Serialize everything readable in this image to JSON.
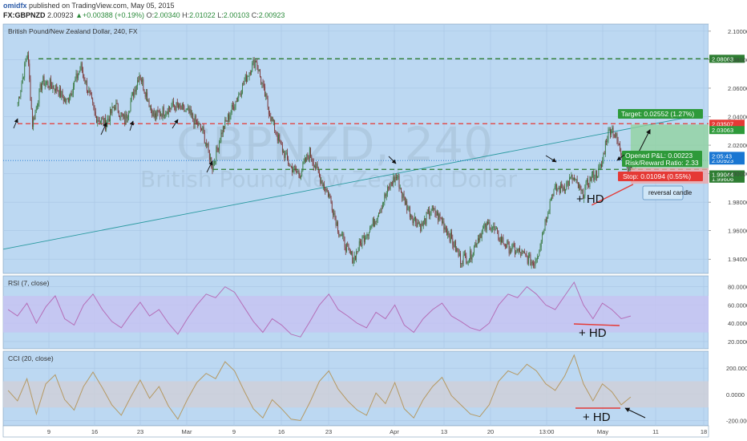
{
  "header": {
    "author": "omidfx",
    "published": "published on TradingView.com, May 05, 2015",
    "symbol": "FX:GBPNZD",
    "price": "2.00923",
    "change": "+0.00388 (+0.19%)",
    "open_label": "O:",
    "open": "2.00340",
    "high_label": "H:",
    "high": "2.01022",
    "low_label": "L:",
    "low": "2.00103",
    "close_label": "C:",
    "close": "2.00923"
  },
  "chart_data": [
    {
      "type": "candlestick",
      "title": "British Pound/New Zealand Dollar, 240, FX",
      "watermark": "GBPNZD, 240",
      "watermark_sub": "British Pound/New Zealand Dollar",
      "x_tick_labels": [
        "9",
        "16",
        "23",
        "Mar",
        "9",
        "16",
        "23",
        "Apr",
        "13",
        "20",
        "13:00",
        "May",
        "11",
        "18"
      ],
      "y_tick_labels": [
        "2.10000",
        "2.08000",
        "2.06000",
        "2.04000",
        "2.02000",
        "2.00000",
        "1.98000",
        "1.96000",
        "1.94000"
      ],
      "ylim": [
        1.93,
        2.105
      ],
      "series": [
        {
          "values": [
            {
              "day": 0,
              "close": 2.05
            },
            {
              "day": 2,
              "close": 2.085
            },
            {
              "day": 3,
              "close": 2.035
            },
            {
              "day": 5,
              "close": 2.065
            },
            {
              "day": 8,
              "close": 2.06
            },
            {
              "day": 10,
              "close": 2.05
            },
            {
              "day": 13,
              "close": 2.075
            },
            {
              "day": 16,
              "close": 2.04
            },
            {
              "day": 18,
              "close": 2.035
            },
            {
              "day": 20,
              "close": 2.048
            },
            {
              "day": 22,
              "close": 2.037
            },
            {
              "day": 25,
              "close": 2.07
            },
            {
              "day": 28,
              "close": 2.04
            },
            {
              "day": 32,
              "close": 2.048
            },
            {
              "day": 35,
              "close": 2.043
            },
            {
              "day": 38,
              "close": 2.03
            },
            {
              "day": 40,
              "close": 2.005
            },
            {
              "day": 42,
              "close": 2.03
            },
            {
              "day": 44,
              "close": 2.045
            },
            {
              "day": 46,
              "close": 2.06
            },
            {
              "day": 48,
              "close": 2.075
            },
            {
              "day": 49,
              "close": 2.08
            },
            {
              "day": 50,
              "close": 2.065
            },
            {
              "day": 52,
              "close": 2.04
            },
            {
              "day": 54,
              "close": 2.02
            },
            {
              "day": 56,
              "close": 2.005
            },
            {
              "day": 58,
              "close": 2.0
            },
            {
              "day": 60,
              "close": 2.015
            },
            {
              "day": 62,
              "close": 1.998
            },
            {
              "day": 64,
              "close": 1.985
            },
            {
              "day": 66,
              "close": 1.96
            },
            {
              "day": 68,
              "close": 1.945
            },
            {
              "day": 69,
              "close": 1.94
            },
            {
              "day": 71,
              "close": 1.955
            },
            {
              "day": 73,
              "close": 1.965
            },
            {
              "day": 75,
              "close": 1.98
            },
            {
              "day": 77,
              "close": 1.995
            },
            {
              "day": 78,
              "close": 1.998
            },
            {
              "day": 79,
              "close": 1.985
            },
            {
              "day": 81,
              "close": 1.97
            },
            {
              "day": 83,
              "close": 1.963
            },
            {
              "day": 85,
              "close": 1.975
            },
            {
              "day": 87,
              "close": 1.968
            },
            {
              "day": 89,
              "close": 1.955
            },
            {
              "day": 91,
              "close": 1.94
            },
            {
              "day": 93,
              "close": 1.942
            },
            {
              "day": 95,
              "close": 1.958
            },
            {
              "day": 97,
              "close": 1.965
            },
            {
              "day": 99,
              "close": 1.955
            },
            {
              "day": 101,
              "close": 1.948
            },
            {
              "day": 103,
              "close": 1.945
            },
            {
              "day": 105,
              "close": 1.94
            },
            {
              "day": 106,
              "close": 1.937
            },
            {
              "day": 107,
              "close": 1.945
            },
            {
              "day": 108,
              "close": 1.96
            },
            {
              "day": 109,
              "close": 1.975
            },
            {
              "day": 110,
              "close": 1.988
            },
            {
              "day": 112,
              "close": 1.99
            },
            {
              "day": 114,
              "close": 1.997
            },
            {
              "day": 115,
              "close": 1.992
            },
            {
              "day": 116,
              "close": 1.985
            },
            {
              "day": 117,
              "close": 1.992
            },
            {
              "day": 118,
              "close": 1.998
            },
            {
              "day": 119,
              "close": 2.0
            },
            {
              "day": 120,
              "close": 2.005
            },
            {
              "day": 121,
              "close": 2.025
            },
            {
              "day": 122,
              "close": 2.033
            },
            {
              "day": 123,
              "close": 2.025
            },
            {
              "day": 124,
              "close": 2.015
            },
            {
              "day": 125,
              "close": 2.008
            },
            {
              "day": 126,
              "close": 2.004
            },
            {
              "day": 127,
              "close": 2.009
            }
          ]
        }
      ],
      "levels": [
        {
          "name": "resistance-top",
          "value": 2.08063,
          "label": "2.08063",
          "color": "#2e7d32",
          "style": "dashed"
        },
        {
          "name": "resistance-mid",
          "value": 2.03507,
          "label": "2.03507",
          "color": "#e53935",
          "style": "dashed"
        },
        {
          "name": "support",
          "value": 2.003,
          "label": "1.99606",
          "color": "#2e7d32",
          "style": "dashed"
        },
        {
          "name": "last-price",
          "value": 2.00923,
          "label": "2.00923",
          "color": "#1976d2",
          "style": "dotted"
        }
      ],
      "trendline": {
        "from": {
          "day": -3,
          "value": 1.947
        },
        "to": {
          "day": 140,
          "value": 2.041
        }
      },
      "annotations": {
        "target": "Target: 0.02552 (1.27%)",
        "pnl": "Opened P&L: 0.00223",
        "risk_reward": "Risk/Reward Ratio: 2.33",
        "stop": "Stop: 0.01094 (0.55%)",
        "reversal": "reversal candle",
        "hd": "+ HD",
        "target_tag": "2.03063",
        "time_tag": "2:05:43",
        "stop_tag": "1.99044"
      }
    },
    {
      "type": "line",
      "title": "RSI (7, close)",
      "y_tick_labels": [
        "80.0000",
        "60.0000",
        "40.0000",
        "20.0000"
      ],
      "ylim": [
        12,
        92
      ],
      "band": [
        30,
        70
      ],
      "series": [
        {
          "name": "",
          "values": [
            55,
            48,
            62,
            40,
            58,
            70,
            45,
            38,
            60,
            72,
            55,
            42,
            35,
            50,
            63,
            48,
            55,
            40,
            28,
            45,
            60,
            72,
            68,
            80,
            74,
            58,
            42,
            30,
            45,
            38,
            28,
            25,
            42,
            60,
            72,
            55,
            48,
            40,
            35,
            52,
            45,
            60,
            38,
            30,
            45,
            55,
            62,
            48,
            42,
            35,
            32,
            40,
            60,
            72,
            68,
            80,
            72,
            60,
            55,
            70,
            85,
            60,
            45,
            62,
            55,
            45,
            48
          ]
        }
      ],
      "annotation": "+ HD"
    },
    {
      "type": "line",
      "title": "CCI (20, close)",
      "y_tick_labels": [
        "200.0000",
        "0.0000",
        "-200.0000"
      ],
      "ylim": [
        -240,
        330
      ],
      "band": [
        -100,
        100
      ],
      "series": [
        {
          "name": "",
          "values": [
            30,
            -50,
            120,
            -150,
            80,
            150,
            -40,
            -120,
            60,
            170,
            50,
            -80,
            -160,
            -20,
            110,
            -30,
            60,
            -90,
            -190,
            -40,
            90,
            160,
            120,
            250,
            180,
            30,
            -110,
            -180,
            -40,
            -110,
            -190,
            -200,
            -60,
            100,
            180,
            40,
            -50,
            -120,
            -160,
            10,
            -70,
            90,
            -110,
            -180,
            -40,
            60,
            130,
            -10,
            -80,
            -150,
            -170,
            -80,
            100,
            180,
            150,
            230,
            180,
            80,
            30,
            140,
            300,
            80,
            -50,
            80,
            20,
            -80,
            -20
          ]
        }
      ],
      "annotation": "+ HD"
    }
  ],
  "colors": {
    "background": "#bcd8f2",
    "grid": "#a9c6e4",
    "bull_candle": "#3a7a43",
    "bear_candle": "#7a3535",
    "rsi_line": "#b46fb8",
    "rsi_band": "#c8c2f2",
    "cci_line": "#b59963",
    "cci_band": "#d2cfd6",
    "red": "#e53935",
    "green_box": "#2e9a3a",
    "red_box": "#e53935"
  }
}
